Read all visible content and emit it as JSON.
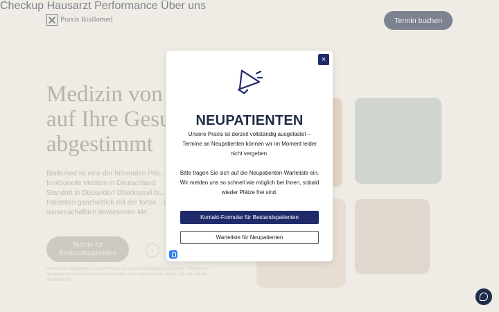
{
  "header": {
    "logo_text": "Praxis Biallomed",
    "nav": [
      "Checkup",
      "Hausarzt",
      "Performance",
      "Über uns"
    ],
    "cta_label": "Termin buchen"
  },
  "hero": {
    "title_lines": [
      "Medizin von",
      "auf Ihre Gesu",
      "abgestimmt"
    ],
    "text": "Biallomed ist eine der führenden Priv... funktionelle Medizin in Deutschland. Standort in Düsseldorf Oberkassel bi... Patienten ganzheitlich mit der fortsc... und wissenschaftlich bewiesenen Me...",
    "button_label": "Termin für Bestandspatienten",
    "arrow": "‹",
    "note": "Hinweis für Neupatienten: Unsere Praxis ist derzeit vollständig ausgelastet – Termine an Neupatienten können wir im Moment leider nicht vergeben. Bitte tragen Sie sich auf die Warteliste ein."
  },
  "modal": {
    "close_glyph": "×",
    "title": "NEUPATIENTEN",
    "text_1": "Unsere Praxis ist derzeit vollständig ausgelastet – Termine an Neupatienten können wir im Moment leider nicht vergeben.",
    "text_2": "Bitte tragen Sie sich auf die Neupatienten-Warteliste ein. Wir melden uns so schnell wie möglich bei Ihnen, sobald wieder Plätze frei sind.",
    "primary_label": "Kontakt-Formular für Bestandspatienten",
    "secondary_label": "Warteliste für Neupatienten"
  },
  "colors": {
    "navy": "#1e2c4a",
    "modal_button": "#1f2a6b",
    "background": "#efece6"
  }
}
